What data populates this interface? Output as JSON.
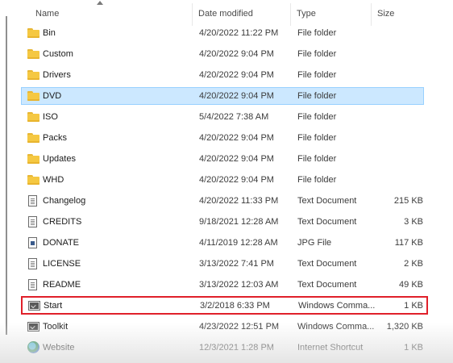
{
  "columns": {
    "name": "Name",
    "date_modified": "Date modified",
    "type": "Type",
    "size": "Size"
  },
  "files": [
    {
      "name": "Bin",
      "date": "4/20/2022 11:22 PM",
      "type": "File folder",
      "size": "",
      "icon": "folder-icon"
    },
    {
      "name": "Custom",
      "date": "4/20/2022 9:04 PM",
      "type": "File folder",
      "size": "",
      "icon": "folder-icon"
    },
    {
      "name": "Drivers",
      "date": "4/20/2022 9:04 PM",
      "type": "File folder",
      "size": "",
      "icon": "folder-icon"
    },
    {
      "name": "DVD",
      "date": "4/20/2022 9:04 PM",
      "type": "File folder",
      "size": "",
      "icon": "folder-icon"
    },
    {
      "name": "ISO",
      "date": "5/4/2022 7:38 AM",
      "type": "File folder",
      "size": "",
      "icon": "folder-icon"
    },
    {
      "name": "Packs",
      "date": "4/20/2022 9:04 PM",
      "type": "File folder",
      "size": "",
      "icon": "folder-icon"
    },
    {
      "name": "Updates",
      "date": "4/20/2022 9:04 PM",
      "type": "File folder",
      "size": "",
      "icon": "folder-icon"
    },
    {
      "name": "WHD",
      "date": "4/20/2022 9:04 PM",
      "type": "File folder",
      "size": "",
      "icon": "folder-icon"
    },
    {
      "name": "Changelog",
      "date": "4/20/2022 11:33 PM",
      "type": "Text Document",
      "size": "215 KB",
      "icon": "text-document-icon"
    },
    {
      "name": "CREDITS",
      "date": "9/18/2021 12:28 AM",
      "type": "Text Document",
      "size": "3 KB",
      "icon": "text-document-icon"
    },
    {
      "name": "DONATE",
      "date": "4/11/2019 12:28 AM",
      "type": "JPG File",
      "size": "117 KB",
      "icon": "image-file-icon"
    },
    {
      "name": "LICENSE",
      "date": "3/13/2022 7:41 PM",
      "type": "Text Document",
      "size": "2 KB",
      "icon": "text-document-icon"
    },
    {
      "name": "README",
      "date": "3/13/2022 12:03 AM",
      "type": "Text Document",
      "size": "49 KB",
      "icon": "text-document-icon"
    },
    {
      "name": "Start",
      "date": "3/2/2018 6:33 PM",
      "type": "Windows Comma...",
      "size": "1 KB",
      "icon": "command-script-icon"
    },
    {
      "name": "Toolkit",
      "date": "4/23/2022 12:51 PM",
      "type": "Windows Comma...",
      "size": "1,320 KB",
      "icon": "command-script-icon"
    },
    {
      "name": "Website",
      "date": "12/3/2021 1:28 PM",
      "type": "Internet Shortcut",
      "size": "1 KB",
      "icon": "web-shortcut-icon"
    }
  ],
  "selected_item": "DVD",
  "highlighted_item": "Start",
  "colors": {
    "selection_bg": "#cce8ff",
    "selection_border": "#99d1ff",
    "highlight_border": "#e0202a",
    "folder": "#f5c842"
  }
}
